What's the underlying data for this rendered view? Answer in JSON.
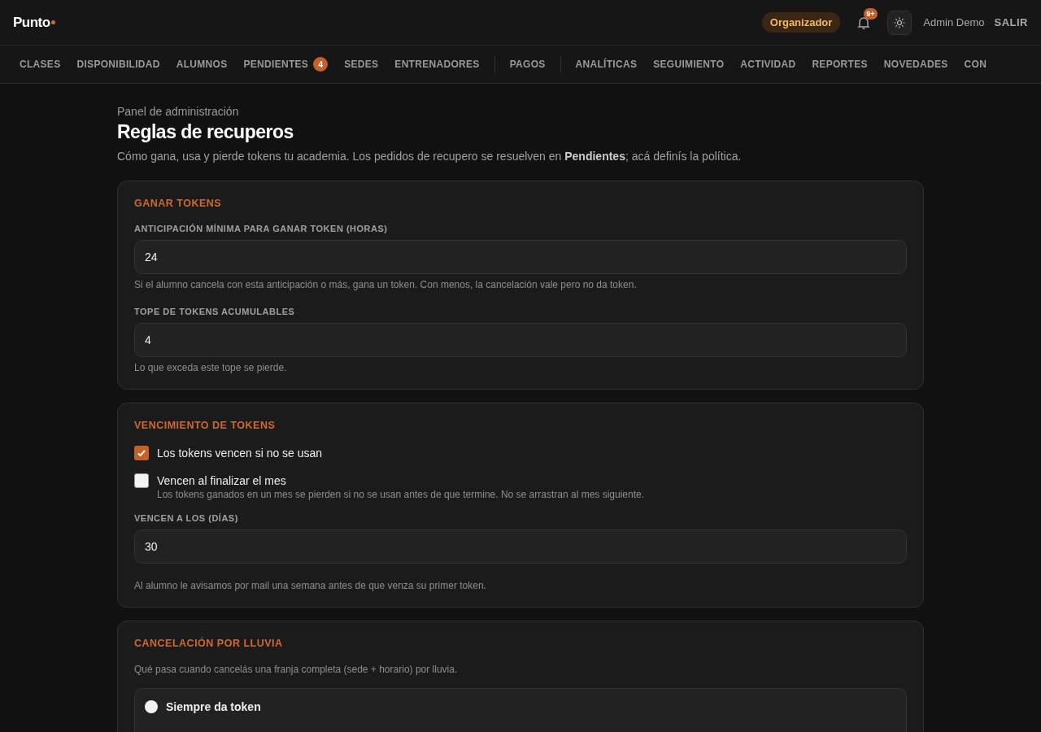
{
  "header": {
    "logo": "Punto",
    "role_badge": "Organizador",
    "notifications_badge": "9+",
    "user_name": "Admin Demo",
    "logout": "SALIR"
  },
  "nav": [
    {
      "label": "CLASES"
    },
    {
      "label": "DISPONIBILIDAD"
    },
    {
      "label": "ALUMNOS"
    },
    {
      "label": "PENDIENTES",
      "badge": "4"
    },
    {
      "label": "SEDES"
    },
    {
      "label": "ENTRENADORES",
      "divider_after": true
    },
    {
      "label": "PAGOS",
      "divider_after": true
    },
    {
      "label": "ANALÍTICAS"
    },
    {
      "label": "SEGUIMIENTO"
    },
    {
      "label": "ACTIVIDAD"
    },
    {
      "label": "REPORTES"
    },
    {
      "label": "NOVEDADES"
    },
    {
      "label": "CON"
    }
  ],
  "page": {
    "eyebrow": "Panel de administración",
    "title": "Reglas de recuperos",
    "description": "Cómo gana, usa y pierde tokens tu academia. Los pedidos de recupero se resuelven en **Pendientes**; acá definís la política."
  },
  "sections": [
    {
      "title": "GANAR TOKENS",
      "items": [
        {
          "kind": "number",
          "label": "ANTICIPACIÓN MÍNIMA PARA GANAR TOKEN (HORAS)",
          "value": "24",
          "help": "Si el alumno cancela con esta anticipación o más, gana un token. Con menos, la cancelación vale pero no da token."
        },
        {
          "kind": "number",
          "label": "TOPE DE TOKENS ACUMULABLES",
          "value": "4",
          "help": "Lo que exceda este tope se pierde."
        }
      ]
    },
    {
      "title": "VENCIMIENTO DE TOKENS",
      "items": [
        {
          "kind": "checkbox",
          "label": "Los tokens vencen si no se usan",
          "checked": true
        },
        {
          "kind": "checkbox",
          "label": "Vencen al finalizar el mes",
          "checked": false,
          "help": "Los tokens ganados en un mes se pierden si no se usan antes de que termine. No se arrastran al mes siguiente."
        },
        {
          "kind": "number",
          "label": "VENCEN A LOS (DÍAS)",
          "value": "30"
        },
        {
          "kind": "note",
          "text": "Al alumno le avisamos por mail una semana antes de que venza su primer token."
        }
      ]
    },
    {
      "title": "CANCELACIÓN POR LLUVIA",
      "items": [
        {
          "kind": "note",
          "text": "Qué pasa cuando cancelás una franja completa (sede + horario) por lluvia."
        },
        {
          "kind": "radio",
          "label": "Siempre da token",
          "selected": false
        }
      ]
    }
  ]
}
